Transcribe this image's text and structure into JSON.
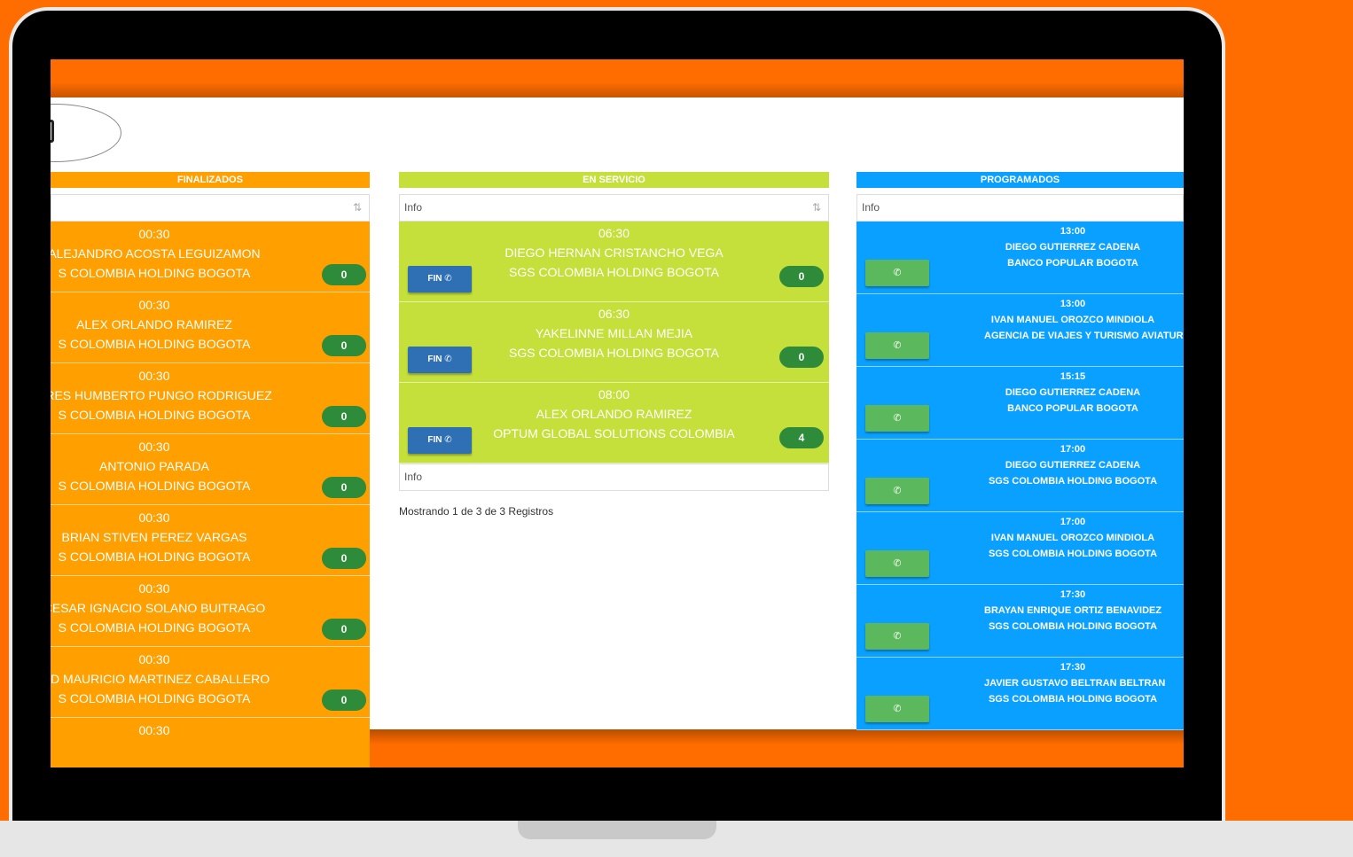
{
  "finalizados": {
    "header": "FINALIZADOS",
    "info_icon": "sort-icon",
    "cards": [
      {
        "time": "00:30",
        "name": "ALEJANDRO ACOSTA LEGUIZAMON",
        "company": "S COLOMBIA HOLDING BOGOTA",
        "count": "0"
      },
      {
        "time": "00:30",
        "name": "ALEX ORLANDO RAMIREZ",
        "company": "S COLOMBIA HOLDING BOGOTA",
        "count": "0"
      },
      {
        "time": "00:30",
        "name": "DRES HUMBERTO PUNGO RODRIGUEZ",
        "company": "S COLOMBIA HOLDING BOGOTA",
        "count": "0"
      },
      {
        "time": "00:30",
        "name": "ANTONIO PARADA",
        "company": "S COLOMBIA HOLDING BOGOTA",
        "count": "0"
      },
      {
        "time": "00:30",
        "name": "BRIAN STIVEN PEREZ VARGAS",
        "company": "S COLOMBIA HOLDING BOGOTA",
        "count": "0"
      },
      {
        "time": "00:30",
        "name": "CESAR IGNACIO SOLANO BUITRAGO",
        "company": "S COLOMBIA HOLDING BOGOTA",
        "count": "0"
      },
      {
        "time": "00:30",
        "name": "VID MAURICIO MARTINEZ CABALLERO",
        "company": "S COLOMBIA HOLDING BOGOTA",
        "count": "0"
      },
      {
        "time": "00:30",
        "name": "",
        "company": "",
        "count": ""
      }
    ]
  },
  "en_servicio": {
    "header": "EN SERVICIO",
    "info_label": "Info",
    "footer_label": "Info",
    "fin_label": "FIN",
    "showing": "Mostrando 1 de 3 de 3 Registros",
    "cards": [
      {
        "time": "06:30",
        "name": "DIEGO HERNAN CRISTANCHO VEGA",
        "company": "SGS COLOMBIA HOLDING BOGOTA",
        "count": "0"
      },
      {
        "time": "06:30",
        "name": "YAKELINNE MILLAN MEJIA",
        "company": "SGS COLOMBIA HOLDING BOGOTA",
        "count": "0"
      },
      {
        "time": "08:00",
        "name": "ALEX ORLANDO RAMIREZ",
        "company": "OPTUM GLOBAL SOLUTIONS COLOMBIA",
        "count": "4"
      }
    ]
  },
  "programados": {
    "header": "PROGRAMADOS",
    "info_label": "Info",
    "call_icon": "phone-icon",
    "cards": [
      {
        "time": "13:00",
        "name": "DIEGO GUTIERREZ CADENA",
        "company": "BANCO POPULAR BOGOTA"
      },
      {
        "time": "13:00",
        "name": "IVAN MANUEL OROZCO MINDIOLA",
        "company": "AGENCIA DE VIAJES Y TURISMO AVIATUR"
      },
      {
        "time": "15:15",
        "name": "DIEGO GUTIERREZ CADENA",
        "company": "BANCO POPULAR BOGOTA"
      },
      {
        "time": "17:00",
        "name": "DIEGO GUTIERREZ CADENA",
        "company": "SGS COLOMBIA HOLDING BOGOTA"
      },
      {
        "time": "17:00",
        "name": "IVAN MANUEL OROZCO MINDIOLA",
        "company": "SGS COLOMBIA HOLDING BOGOTA"
      },
      {
        "time": "17:30",
        "name": "BRAYAN ENRIQUE ORTIZ BENAVIDEZ",
        "company": "SGS COLOMBIA HOLDING BOGOTA"
      },
      {
        "time": "17:30",
        "name": "JAVIER GUSTAVO BELTRAN BELTRAN",
        "company": "SGS COLOMBIA HOLDING BOGOTA"
      }
    ]
  },
  "colors": {
    "background": "#ff6d00",
    "finalizados": "#ffa000",
    "en_servicio": "#c5e03a",
    "programados": "#0aa0ff",
    "badge": "#2e8b3a",
    "fin_button": "#2f6fb3",
    "call_button": "#5cb85c"
  }
}
